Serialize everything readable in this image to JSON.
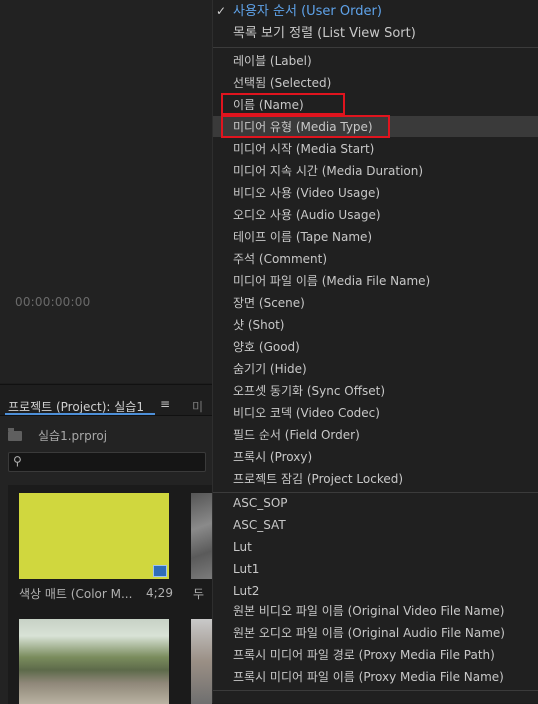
{
  "monitor": {
    "timecode": "00:00:00:00"
  },
  "project": {
    "tab_label": "프로젝트 (Project): 실습1",
    "tab_menu_glyph": "≡",
    "next_tab_peek": "미",
    "file_name": "실습1.prproj",
    "search_glyph": "⚲",
    "thumbs": [
      {
        "label": "색상 매트 (Color M...",
        "duration": "4;29"
      },
      {
        "label": "두"
      }
    ]
  },
  "menu": {
    "items": [
      "사용자 순서 (User Order)",
      "목록 보기 정렬 (List View Sort)",
      "레이블 (Label)",
      "선택됨 (Selected)",
      "이름 (Name)",
      "미디어 유형 (Media Type)",
      "미디어 시작 (Media Start)",
      "미디어 지속 시간 (Media Duration)",
      "비디오 사용 (Video Usage)",
      "오디오 사용 (Audio Usage)",
      "테이프 이름 (Tape Name)",
      "주석 (Comment)",
      "미디어 파일 이름 (Media File Name)",
      "장면 (Scene)",
      "샷 (Shot)",
      "양호 (Good)",
      "숨기기 (Hide)",
      "오프셋 동기화 (Sync Offset)",
      "비디오 코덱 (Video Codec)",
      "필드 순서 (Field Order)",
      "프록시 (Proxy)",
      "프로젝트 잠김 (Project Locked)",
      "ASC_SOP",
      "ASC_SAT",
      "Lut",
      "Lut1",
      "Lut2",
      "원본 비디오 파일 이름 (Original Video File Name)",
      "원본 오디오 파일 이름 (Original Audio File Name)",
      "프록시 미디어 파일 경로 (Proxy Media File Path)",
      "프록시 미디어 파일 이름 (Proxy Media File Name)"
    ],
    "checked_item": "사용자 순서 (User Order)",
    "highlighted_item": "미디어 유형 (Media Type)",
    "boxed_items": [
      "이름 (Name)",
      "미디어 유형 (Media Type)"
    ],
    "accent_color": "#5fa3ea",
    "highlight_box_color": "#e0141e",
    "check_glyph": "✓"
  }
}
